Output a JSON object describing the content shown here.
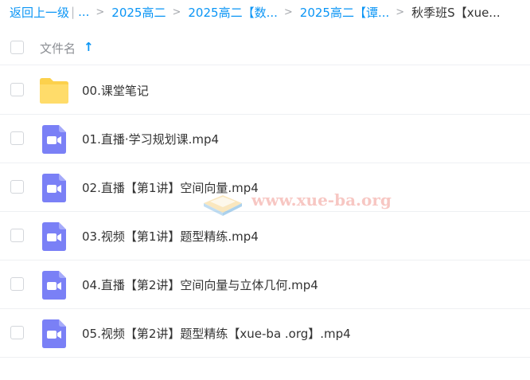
{
  "breadcrumb": {
    "back": "返回上一级",
    "ellipsis": "...",
    "items": [
      "2025高二",
      "2025高二【数...",
      "2025高二【谭..."
    ],
    "current": "秋季班S【xue..."
  },
  "list_header": {
    "name_column": "文件名",
    "sort_icon": "arrow-up-icon"
  },
  "files": [
    {
      "name": "00.课堂笔记",
      "type": "folder",
      "icon": "folder-icon"
    },
    {
      "name": "01.直播·学习规划课.mp4",
      "type": "video",
      "icon": "video-icon"
    },
    {
      "name": "02.直播【第1讲】空间向量.mp4",
      "type": "video",
      "icon": "video-icon"
    },
    {
      "name": "03.视频【第1讲】题型精练.mp4",
      "type": "video",
      "icon": "video-icon"
    },
    {
      "name": "04.直播【第2讲】空间向量与立体几何.mp4",
      "type": "video",
      "icon": "video-icon"
    },
    {
      "name": "05.视频【第2讲】题型精练【xue-ba .org】.mp4",
      "type": "video",
      "icon": "video-icon"
    }
  ],
  "watermark": "www.xue-ba.org",
  "colors": {
    "link": "#0a95f5",
    "folder": "#fcd14c",
    "video": "#7a80f6",
    "watermark": "#f29a93"
  }
}
